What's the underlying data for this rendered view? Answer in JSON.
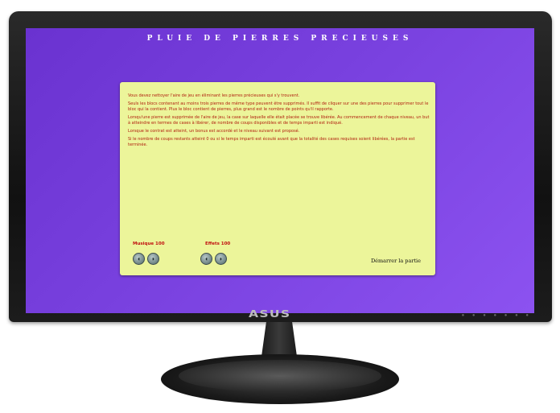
{
  "game": {
    "title": "PLUIE DE PIERRES PRECIEUSES",
    "rules": [
      "Vous devez nettoyer l'aire de jeu en éliminant les pierres précieuses qui s'y trouvent.",
      "Seuls les blocs contenant au moins trois pierres de même type peuvent être supprimés. Il suffit de cliquer sur une des pierres pour supprimer tout le bloc qui la contient. Plus le bloc contient de pierres, plus grand est le nombre de points qu'il rapporte.",
      "Lorsqu'une pierre est supprimée de l'aire de jeu, la case sur laquelle elle était placée se trouve libérée. Au commencement de chaque niveau, un but à atteindre en termes de cases à libérer, de nombre de coups disponibles et de temps imparti est indiqué.",
      "Lorsque le contrat est atteint, un bonus est accordé et le niveau suivant est proposé.",
      "Si le nombre de coups restants atteint 0 ou si le temps imparti est écoulé avant que la totalité des cases requises soient libérées, la partie est terminée."
    ],
    "music_label": "Musique 100",
    "effects_label": "Effets 100",
    "start_label": "Démarrer la partie"
  },
  "monitor": {
    "brand": "ASUS"
  },
  "icons": {
    "volume_down": "volume-down-icon",
    "volume_up": "volume-up-icon"
  },
  "colors": {
    "screen": "#7a42e0",
    "panel": "#ecf59a",
    "rules_text": "#b02010",
    "labels": "#c01010"
  }
}
